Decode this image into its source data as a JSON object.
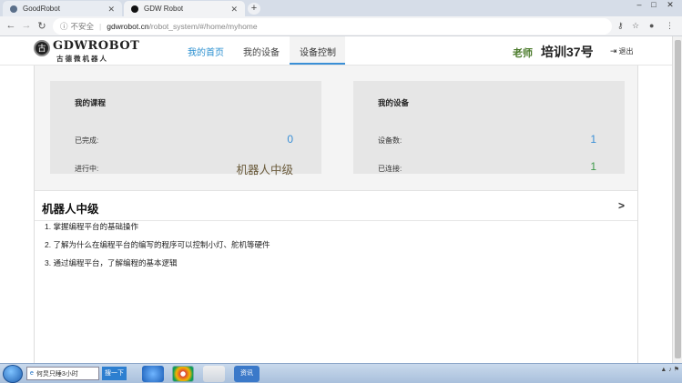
{
  "browser": {
    "tabs": [
      {
        "title": "GoodRobot",
        "active": false
      },
      {
        "title": "GDW Robot",
        "active": true
      }
    ],
    "new_tab": "+",
    "nav": {
      "back": "←",
      "forward": "→",
      "reload": "C"
    },
    "address": {
      "security_label": "不安全",
      "host": "gdwrobot.cn",
      "path": "/robot_system/#/home/myhome"
    }
  },
  "site": {
    "logo": {
      "brand": "GDWROBOT",
      "subtitle": "古德微机器人"
    },
    "nav": [
      {
        "label": "我的首页"
      },
      {
        "label": "我的设备"
      },
      {
        "label": "设备控制"
      }
    ],
    "user": {
      "role": "老师",
      "name": "培训37号"
    },
    "logout_label": "退出"
  },
  "courses_card": {
    "title": "我的课程",
    "completed_label": "已完成:",
    "completed_value": "0",
    "in_progress_label": "进行中:",
    "in_progress_value": "机器人中级"
  },
  "devices_card": {
    "title": "我的设备",
    "count_label": "设备数:",
    "count_value": "1",
    "connected_label": "已连接:",
    "connected_value": "1"
  },
  "course_section": {
    "title": "机器人中级",
    "items": [
      "1. 掌握编程平台的基础操作",
      "2. 了解为什么在编程平台的编写的程序可以控制小灯、舵机等硬件",
      "3. 通过编程平台，了解编程的基本逻辑"
    ]
  },
  "taskbar": {
    "search_text": "何炅只睡3小时",
    "search_button": "搜一下",
    "app_label": "资讯"
  },
  "colors": {
    "accent": "#3a8fd6",
    "green": "#3f9a4a",
    "card_bg": "#e6e6e6"
  }
}
